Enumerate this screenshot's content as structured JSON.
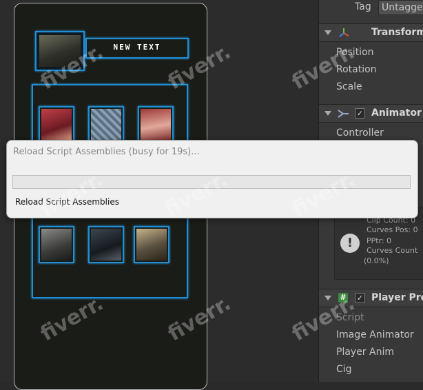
{
  "hud": {
    "name_text": "NEW TEXT"
  },
  "inspector": {
    "tag_label": "Tag",
    "tag_value": "Untagged",
    "transform": {
      "title": "Transform",
      "fields": [
        "Position",
        "Rotation",
        "Scale"
      ]
    },
    "animator": {
      "title": "Animator",
      "fields": [
        "Controller"
      ]
    },
    "info": {
      "clip_count": "Clip Count: 0",
      "curves_pos": "Curves Pos: 0",
      "pptr": "PPtr: 0",
      "curves_count": "Curves Count",
      "percent": "(0.0%)"
    },
    "player_component": {
      "title": "Player Pro",
      "fields": [
        "Script",
        "Image Animator",
        "Player Anim",
        "Cig"
      ]
    }
  },
  "dialog": {
    "title": "Reload Script Assemblies (busy for 19s)...",
    "progress": 0,
    "status": "Reload Script Assemblies"
  },
  "watermark": "fiverr.",
  "colors": {
    "accent": "#1f8fd6",
    "inspector_bg": "#383838",
    "dialog_bg": "#f0f0f0"
  },
  "icons": [
    "transform-axes-icon",
    "animator-icon",
    "checkbox-icon",
    "warning-icon",
    "script-hash-icon"
  ]
}
